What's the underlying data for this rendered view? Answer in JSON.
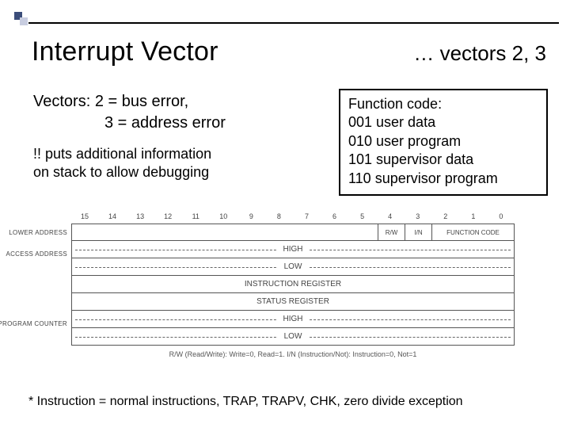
{
  "header": {
    "title": "Interrupt Vector",
    "subtitle": "… vectors 2, 3"
  },
  "body": {
    "line1": "Vectors: 2 = bus error,",
    "line2": "3 = address error",
    "note1": "!! puts additional information",
    "note2": "on stack to allow debugging"
  },
  "funcbox": {
    "title": "Function code:",
    "r1": "001 user data",
    "r2": "010 user program",
    "r3": "101 supervisor data",
    "r4": "110 supervisor program"
  },
  "diagram": {
    "bits": [
      "15",
      "14",
      "13",
      "12",
      "11",
      "10",
      "9",
      "8",
      "7",
      "6",
      "5",
      "4",
      "3",
      "2",
      "1",
      "0"
    ],
    "lower_address": "LOWER ADDRESS",
    "rw": "R/W",
    "in": "I/N",
    "func_code": "FUNCTION CODE",
    "access_address": "ACCESS ADDRESS",
    "high": "HIGH",
    "low": "LOW",
    "instruction_register": "INSTRUCTION REGISTER",
    "status_register": "STATUS REGISTER",
    "program_counter": "PROGRAM COUNTER",
    "legend": "R/W (Read/Write): Write=0, Read=1. I/N (Instruction/Not): Instruction=0, Not=1"
  },
  "footnote": "* Instruction = normal instructions, TRAP, TRAPV, CHK, zero divide exception"
}
